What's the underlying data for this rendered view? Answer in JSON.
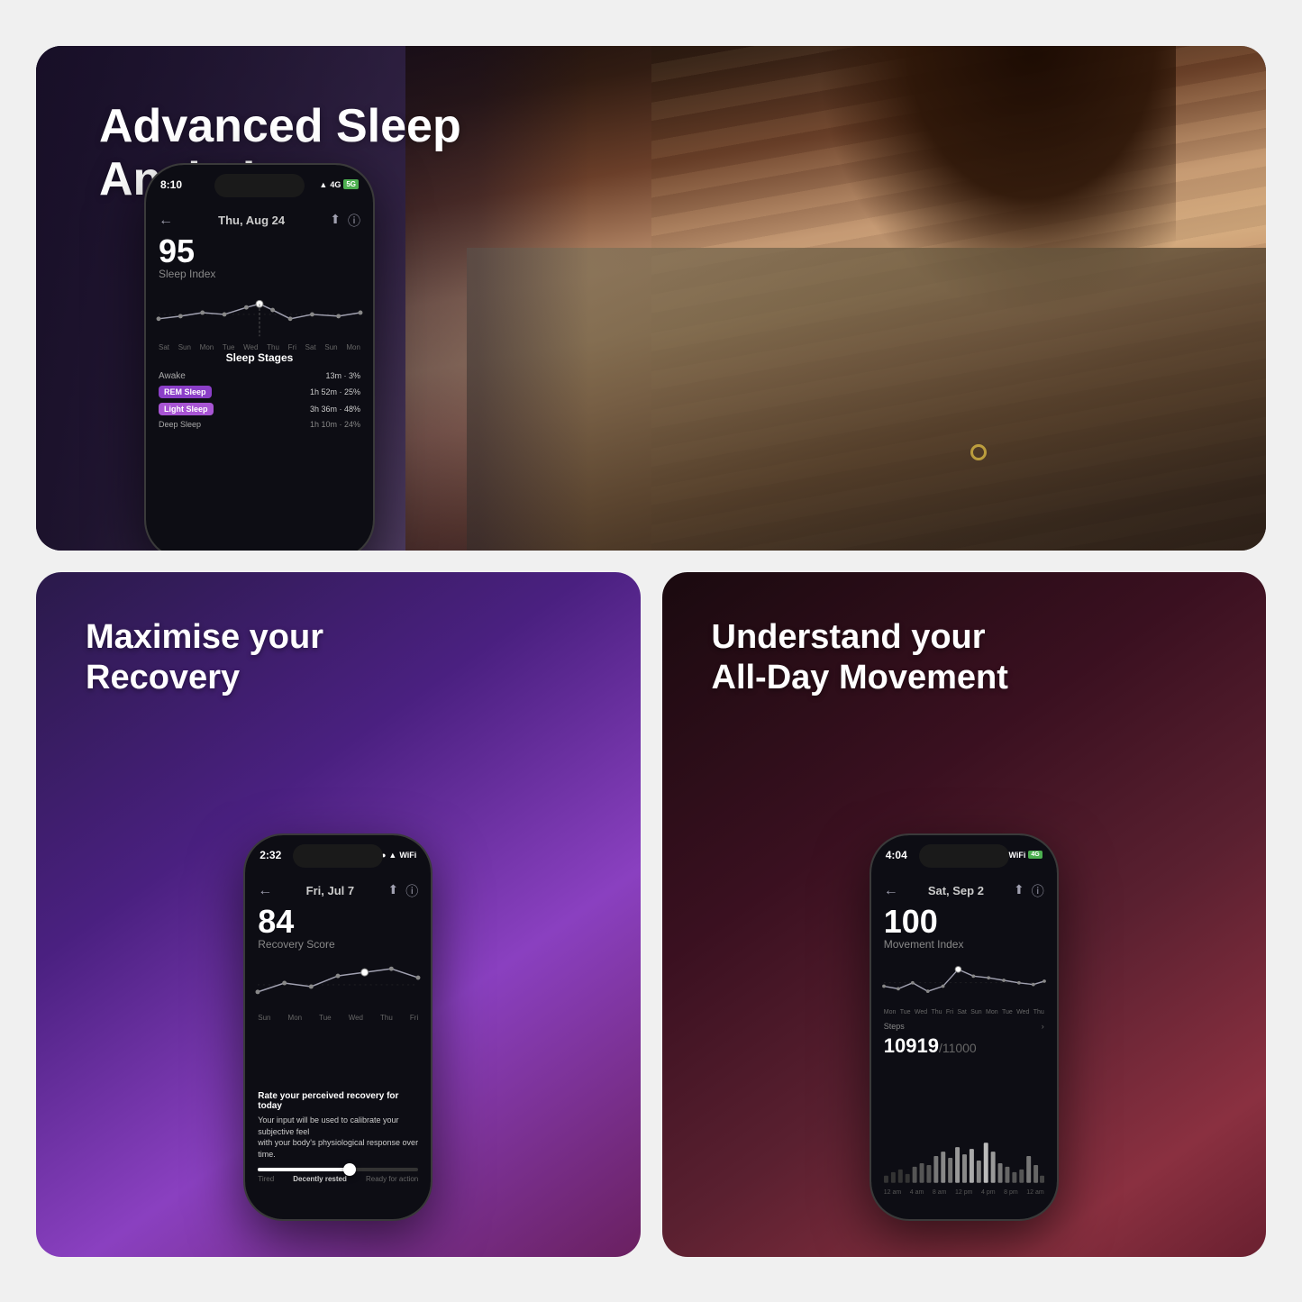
{
  "top_panel": {
    "title_line1": "Advanced Sleep",
    "title_line2": "Analytics",
    "phone": {
      "time": "8:10",
      "status_signal": "●●●",
      "status_network": "4G 5G",
      "nav_date": "Thu, Aug 24",
      "score": "95",
      "score_label": "Sleep Index",
      "chart_labels": [
        "Sat",
        "Sun",
        "Mon",
        "Tue",
        "Wed",
        "Thu",
        "Fri",
        "Sat",
        "Sun",
        "Mon"
      ],
      "section_title": "Sleep Stages",
      "stages": [
        {
          "name": "Awake",
          "value": "13m · 3%",
          "color": "#6b6b8a",
          "bar_width": "10%",
          "type": "plain"
        },
        {
          "name": "REM Sleep",
          "value": "1h 52m · 25%",
          "color": "#8b40cc",
          "bar_width": "38%",
          "type": "pill"
        },
        {
          "name": "Light Sleep",
          "value": "3h 36m · 48%",
          "color": "#9b5cd4",
          "bar_width": "55%",
          "type": "pill"
        },
        {
          "name": "Deep Sleep",
          "value": "1h 10m · 24%",
          "color": "#4a2080",
          "bar_width": "28%",
          "type": "plain"
        }
      ]
    }
  },
  "bottom_left": {
    "title_line1": "Maximise your",
    "title_line2": "Recovery",
    "phone": {
      "time": "2:32",
      "status": "●●● ▲ WiFi",
      "nav_date": "Fri, Jul 7",
      "score": "84",
      "score_label": "Recovery Score",
      "chart_labels": [
        "Sun",
        "Mon",
        "Tue",
        "Wed",
        "Thu",
        "Fri"
      ],
      "slider_title": "Rate your perceived recovery for today",
      "slider_text": "Your input will be used to calibrate your subjective feel\nwith your body's physiological response over time.",
      "slider_labels": [
        "Tired",
        "Decently rested",
        "Ready for action"
      ]
    }
  },
  "bottom_right": {
    "title_line1": "Understand your",
    "title_line2": "All-Day Movement",
    "phone": {
      "time": "4:04",
      "status": "●●● WiFi 4G",
      "nav_date": "Sat, Sep 2",
      "score": "100",
      "score_label": "Movement Index",
      "chart_labels": [
        "Mon",
        "Tue",
        "Wed",
        "Thu",
        "Fri",
        "Sat",
        "Sun",
        "Mon",
        "Tue",
        "Wed",
        "Thu"
      ],
      "steps_label": "Steps",
      "steps_value": "10919",
      "steps_limit": "/11000",
      "bar_labels": [
        "12 am",
        "4 am",
        "8 am",
        "12 pm",
        "4 pm",
        "8 pm",
        "12 am"
      ]
    }
  },
  "colors": {
    "awake": "#6b6b8a",
    "rem": "#8b3fc8",
    "light": "#a855d4",
    "deep": "#4a2080",
    "accent_purple": "#8b3fc8",
    "accent_light_purple": "#c084fc"
  }
}
